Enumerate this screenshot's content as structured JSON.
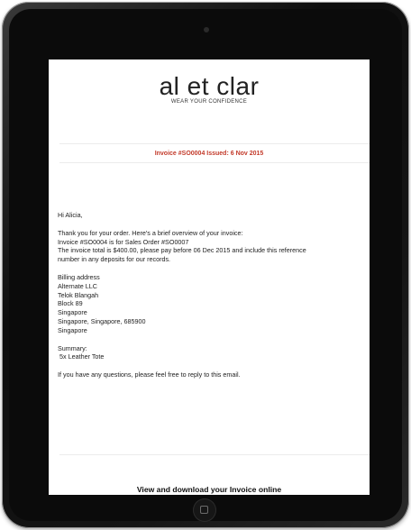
{
  "brand": {
    "name": "al et clar",
    "tagline": "WEAR YOUR CONFIDENCE"
  },
  "invoice_header": "Invoice #SO0004 Issued: 6 Nov 2015",
  "greeting": "Hi Alicia,",
  "intro": [
    "Thank you for your order. Here's a brief overview of your invoice:",
    "Invoice #SO0004 is for Sales Order #SO0007",
    "The invoice total is $400.00, please pay before 06 Dec 2015 and include this reference",
    "number  in any deposits for our records."
  ],
  "billing": {
    "title": "Billing address",
    "lines": [
      "Alternate LLC",
      "Telok Blangah",
      "Block 89",
      "Singapore",
      "Singapore, Singapore, 685900",
      "Singapore"
    ]
  },
  "summary": {
    "title": "Summary:",
    "items": [
      " 5x Leather Tote"
    ]
  },
  "closing": "If you have any questions, please feel free to reply to this email.",
  "cta": "View and download your Invoice online"
}
